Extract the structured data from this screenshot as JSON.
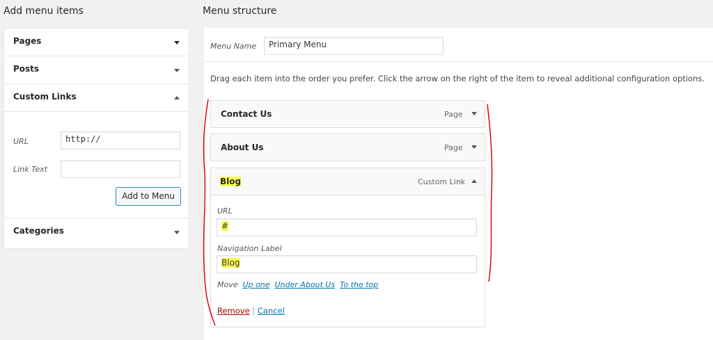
{
  "left": {
    "heading": "Add menu items",
    "sections": {
      "pages": "Pages",
      "posts": "Posts",
      "custom_links": "Custom Links",
      "categories": "Categories"
    },
    "custom_links": {
      "url_label": "URL",
      "url_value": "http://",
      "link_text_label": "Link Text",
      "link_text_value": "",
      "add_button": "Add to Menu"
    }
  },
  "right": {
    "heading": "Menu structure",
    "menu_name_label": "Menu Name",
    "menu_name_value": "Primary Menu",
    "instructions": "Drag each item into the order you prefer. Click the arrow on the right of the item to reveal additional configuration options.",
    "items": [
      {
        "title": "Contact Us",
        "type": "Page"
      },
      {
        "title": "About Us",
        "type": "Page"
      },
      {
        "title": "Blog",
        "type": "Custom Link"
      }
    ],
    "blog_settings": {
      "url_label": "URL",
      "url_value": "#",
      "nav_label_label": "Navigation Label",
      "nav_label_value": "Blog",
      "move_label": "Move",
      "move_links": [
        "Up one",
        "Under About Us",
        "To the top"
      ],
      "remove": "Remove",
      "separator": "|",
      "cancel": "Cancel"
    }
  },
  "colors": {
    "highlight": "#fffd4d",
    "annotation": "#e0001a",
    "link": "#0073aa",
    "remove": "#a00"
  }
}
